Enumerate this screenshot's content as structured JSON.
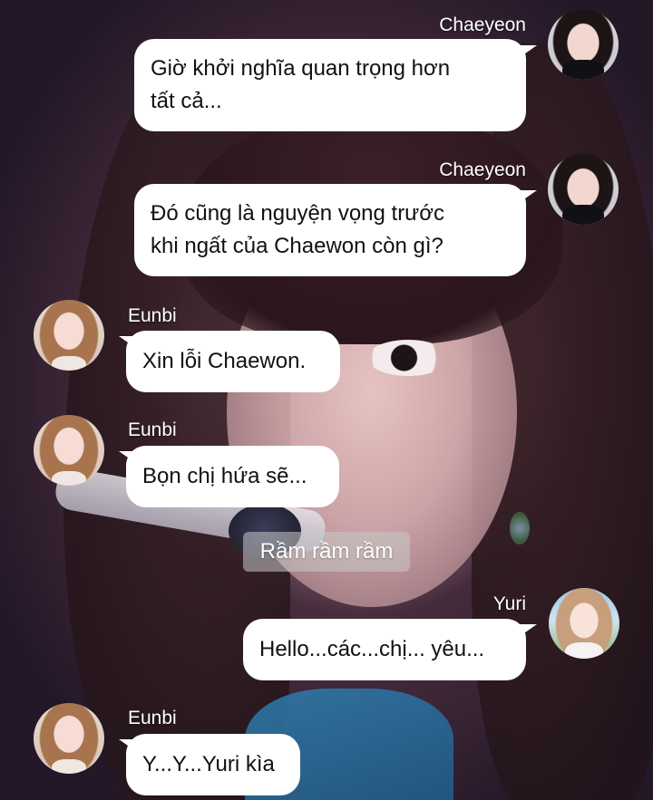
{
  "messages": [
    {
      "sender": "Chaeyeon",
      "text": "Giờ khởi nghĩa quan trọng hơn\ntất cả..."
    },
    {
      "sender": "Chaeyeon",
      "text": "Đó cũng là nguyện vọng trước\nkhi ngất của Chaewon còn gì?"
    },
    {
      "sender": "Eunbi",
      "text": "Xin lỗi Chaewon."
    },
    {
      "sender": "Eunbi",
      "text": "Bọn chị hứa sẽ..."
    },
    {
      "system": "Rầm rầm rầm"
    },
    {
      "sender": "Yuri",
      "text": "Hello...các...chị... yêu..."
    },
    {
      "sender": "Eunbi",
      "text": "Y...Y...Yuri kìa"
    }
  ],
  "colors": {
    "bubble": "#ffffff",
    "text": "#111111",
    "name": "#ffffff",
    "system_bg": "rgba(200,200,200,0.55)"
  }
}
